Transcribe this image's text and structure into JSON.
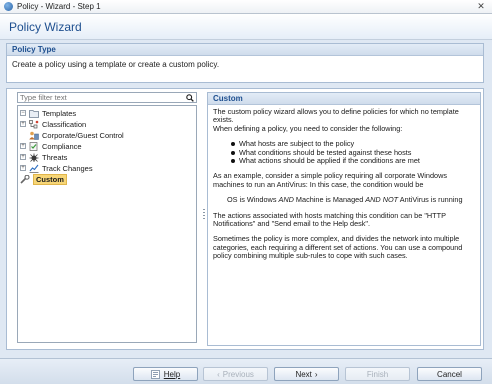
{
  "window": {
    "title": "Policy - Wizard - Step 1",
    "close_glyph": "✕"
  },
  "wizard": {
    "title": "Policy Wizard"
  },
  "policy_type": {
    "header": "Policy Type",
    "description": "Create a policy using a template or create a custom policy."
  },
  "filter": {
    "placeholder": "Type filter text"
  },
  "tree": {
    "root": "Templates",
    "items": [
      {
        "label": "Classification",
        "icon": "classification-icon",
        "expandable": true
      },
      {
        "label": "Corporate/Guest Control",
        "icon": "corporate-guest-icon",
        "expandable": false
      },
      {
        "label": "Compliance",
        "icon": "compliance-icon",
        "expandable": true
      },
      {
        "label": "Threats",
        "icon": "threats-icon",
        "expandable": true
      },
      {
        "label": "Track Changes",
        "icon": "track-changes-icon",
        "expandable": true
      }
    ],
    "custom": "Custom"
  },
  "detail": {
    "header": "Custom",
    "p1": "The custom policy wizard allows you to define policies for which no template exists.",
    "p2": "When defining a policy, you need to consider the following:",
    "bullets": [
      "What hosts are subject to the policy",
      "What conditions should be tested against these hosts",
      "What actions should be applied if the conditions are met"
    ],
    "p3": "As an example, consider a simple policy requiring all corporate Windows machines to run an AntiVirus: In this case, the condition would be",
    "condition": {
      "a": "OS is Windows ",
      "and": "AND",
      "b": " Machine is Managed ",
      "andnot": "AND NOT",
      "c": " AntiVirus is running"
    },
    "p4": "The actions associated with hosts matching this condition can be \"HTTP Notifications\" and \"Send email to the Help desk\".",
    "p5": "Sometimes the policy is more complex, and divides the network into multiple categories, each requiring a different set of actions. You can use a compound policy combining multiple sub-rules to cope with such cases."
  },
  "buttons": {
    "help": "Help",
    "previous": "Previous",
    "next": "Next",
    "finish": "Finish",
    "cancel": "Cancel",
    "previous_enabled": false,
    "finish_enabled": false
  },
  "colors": {
    "accent": "#1e4f8f",
    "selection": "#f7d677",
    "panel_border": "#a9bcd3"
  }
}
